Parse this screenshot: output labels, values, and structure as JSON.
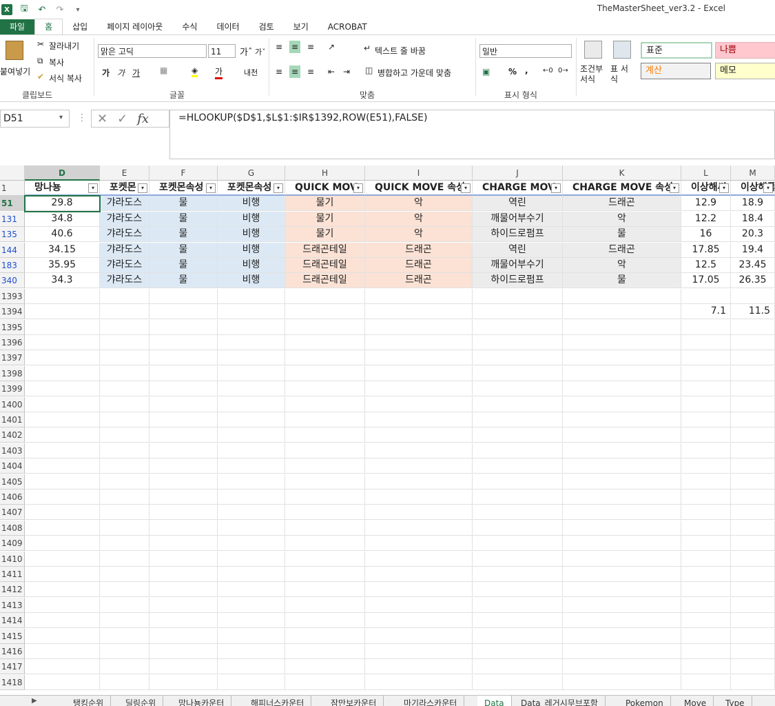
{
  "window_title": "TheMasterSheet_ver3.2 - Excel",
  "ribbon_tabs": [
    "파일",
    "홈",
    "삽입",
    "페이지 레이아웃",
    "수식",
    "데이터",
    "검토",
    "보기",
    "ACROBAT"
  ],
  "clipboard": {
    "paste": "붙여넣기",
    "cut": "잘라내기",
    "copy": "복사",
    "format_painter": "서식 복사",
    "label": "클립보드"
  },
  "font": {
    "name": "맑은 고딕",
    "size": "11",
    "bold": "가",
    "italic": "가",
    "underline": "가",
    "font_color_char": "가",
    "phonetic": "내천",
    "label": "글꼴"
  },
  "alignment": {
    "wrap": "텍스트 줄 바꿈",
    "merge": "병합하고 가운데 맞춤",
    "label": "맞춤"
  },
  "number": {
    "format": "일반",
    "label": "표시 형식",
    "percent": "%",
    "comma": ","
  },
  "styles": {
    "conditional": "조건부 서식",
    "table": "표 서식",
    "normal": "표준",
    "bad": "나쁨",
    "calc": "계산",
    "note": "메모"
  },
  "name_box": "D51",
  "formula": "=HLOOKUP($D$1,$L$1:$IR$1392,ROW(E51),FALSE)",
  "columns": [
    "D",
    "E",
    "F",
    "G",
    "H",
    "I",
    "J",
    "K",
    "L",
    "M"
  ],
  "headers": [
    "망나뇽",
    "포켓몬",
    "포켓몬속성",
    "포켓몬속성",
    "QUICK MOV",
    "QUICK MOVE 속성",
    "CHARGE MOV",
    "CHARGE MOVE 속성",
    "이상해씨",
    "이상해풀"
  ],
  "data_rows": [
    {
      "row": "51",
      "cells": [
        "29.8",
        "갸라도스",
        "물",
        "비행",
        "물기",
        "악",
        "역린",
        "드래곤",
        "12.9",
        "18.9"
      ]
    },
    {
      "row": "131",
      "cells": [
        "34.8",
        "갸라도스",
        "물",
        "비행",
        "물기",
        "악",
        "깨물어부수기",
        "악",
        "12.2",
        "18.4"
      ]
    },
    {
      "row": "135",
      "cells": [
        "40.6",
        "갸라도스",
        "물",
        "비행",
        "물기",
        "악",
        "하이드로펌프",
        "물",
        "16",
        "20.3"
      ]
    },
    {
      "row": "144",
      "cells": [
        "34.15",
        "갸라도스",
        "물",
        "비행",
        "드래곤테일",
        "드래곤",
        "역린",
        "드래곤",
        "17.85",
        "19.4"
      ]
    },
    {
      "row": "183",
      "cells": [
        "35.95",
        "갸라도스",
        "물",
        "비행",
        "드래곤테일",
        "드래곤",
        "깨물어부수기",
        "악",
        "12.5",
        "23.45"
      ]
    },
    {
      "row": "340",
      "cells": [
        "34.3",
        "갸라도스",
        "물",
        "비행",
        "드래곤테일",
        "드래곤",
        "하이드로펌프",
        "물",
        "17.05",
        "26.35"
      ]
    }
  ],
  "empty_rows": [
    "1393",
    "1394",
    "1395",
    "1396",
    "1397",
    "1398",
    "1399",
    "1400",
    "1401",
    "1402",
    "1403",
    "1404",
    "1405",
    "1406",
    "1407",
    "1408",
    "1409",
    "1410",
    "1411",
    "1412",
    "1413",
    "1414",
    "1415",
    "1416",
    "1417",
    "1418"
  ],
  "row_1394_values": {
    "L": "7.1",
    "M": "11.5"
  },
  "sheet_tabs": [
    "탱킹순위",
    "딜링순위",
    "망나뇽카운터",
    "해피너스카운터",
    "잠만보카운터",
    "마기라스카운터",
    "Data",
    "Data_레거시무브포함",
    "Pokemon",
    "Move",
    "Type"
  ],
  "active_sheet": "Data",
  "colors": {
    "accent": "#217346",
    "blue_fill": "#dce9f5",
    "peach_fill": "#fbe2d5",
    "gray_fill": "#ececec",
    "bad_fill": "#ffc7ce",
    "note_fill": "#ffffcc"
  }
}
